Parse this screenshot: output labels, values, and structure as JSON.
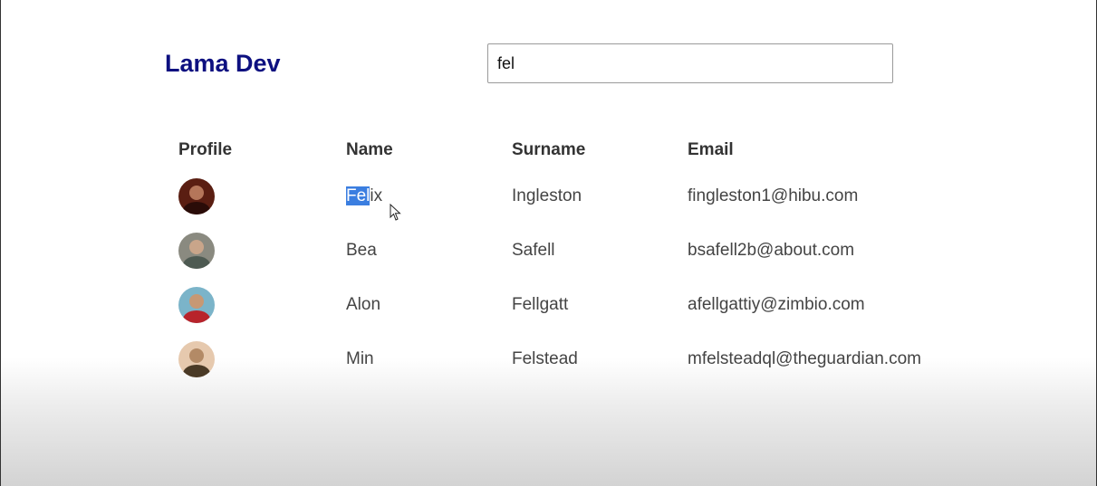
{
  "header": {
    "logo": "Lama Dev"
  },
  "search": {
    "value": "fel"
  },
  "table": {
    "columns": [
      "Profile",
      "Name",
      "Surname",
      "Email"
    ],
    "rows": [
      {
        "name_highlight": "Fel",
        "name_rest": "ix",
        "surname": "Ingleston",
        "email": "fingleston1@hibu.com",
        "avatar_bg": "#5a1e12",
        "avatar_head": "#b5765a",
        "avatar_body": "#2a0c08"
      },
      {
        "name_highlight": "",
        "name_rest": "Bea",
        "surname": "Safell",
        "email": "bsafell2b@about.com",
        "avatar_bg": "#8a8a80",
        "avatar_head": "#c9a58a",
        "avatar_body": "#4e5a52"
      },
      {
        "name_highlight": "",
        "name_rest": "Alon",
        "surname": "Fellgatt",
        "email": "afellgattiy@zimbio.com",
        "avatar_bg": "#7bb4c9",
        "avatar_head": "#c79874",
        "avatar_body": "#b8232b"
      },
      {
        "name_highlight": "",
        "name_rest": "Min",
        "surname": "Felstead",
        "email": "mfelsteadql@theguardian.com",
        "avatar_bg": "#e6c9ae",
        "avatar_head": "#b38a66",
        "avatar_body": "#4a3a26"
      }
    ]
  }
}
